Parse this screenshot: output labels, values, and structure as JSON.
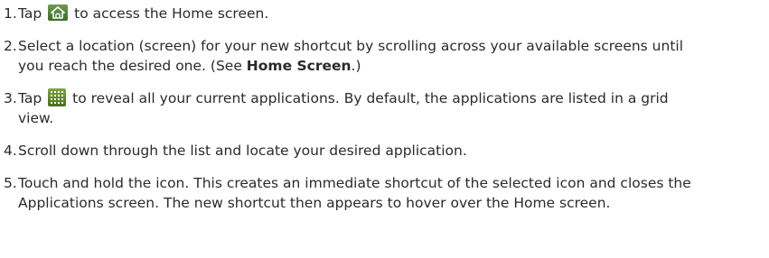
{
  "steps": [
    {
      "number": "1.",
      "before": "Tap",
      "icon": "home-icon",
      "after": "to access the Home screen."
    },
    {
      "number": "2.",
      "line1": "Select a location (screen) for your new shortcut by scrolling across your available screens until",
      "line2_before": "you reach the desired one. (See",
      "line2_bold": "Home Screen",
      "line2_after": ".)"
    },
    {
      "number": "3.",
      "before": "Tap",
      "icon": "applications-grid-icon",
      "after": "to reveal all your current applications. By default, the applications are listed in a grid",
      "line2": "view."
    },
    {
      "number": "4.",
      "text": "Scroll down through the list and locate your desired application."
    },
    {
      "number": "5.",
      "line1": "Touch and hold the icon. This creates an immediate shortcut of the selected icon and closes the",
      "line2": "Applications screen. The new shortcut then appears to hover over the Home screen."
    }
  ],
  "colors": {
    "text": "#2b2b2b",
    "home_icon_bg": "#4f7d3c",
    "grid_icon_bg": "#5a7d2a"
  }
}
